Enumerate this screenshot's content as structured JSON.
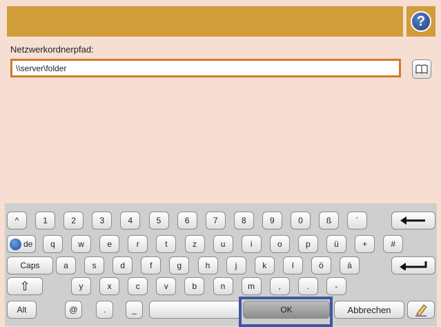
{
  "header": {
    "help_icon": "help-icon",
    "help_glyph": "?"
  },
  "form": {
    "label": "Netzwerkordnerpfad:",
    "value": "\\\\server\\folder",
    "book_icon": "address-book-icon"
  },
  "keyboard": {
    "row1": [
      "^",
      "1",
      "2",
      "3",
      "4",
      "5",
      "6",
      "7",
      "8",
      "9",
      "0",
      "ß",
      "´"
    ],
    "backspace_glyph": "⟵",
    "row2_lang": "de",
    "row2": [
      "q",
      "w",
      "e",
      "r",
      "t",
      "z",
      "u",
      "i",
      "o",
      "p",
      "ü",
      "+",
      "#"
    ],
    "caps": "Caps",
    "row3": [
      "a",
      "s",
      "d",
      "f",
      "g",
      "h",
      "j",
      "k",
      "l",
      "ö",
      "ä"
    ],
    "enter_glyph": "↵",
    "shift_glyph": "⇧",
    "row4": [
      "y",
      "x",
      "c",
      "v",
      "b",
      "n",
      "m",
      ",",
      ".",
      "-"
    ],
    "alt": "Alt",
    "at": "@",
    "dot": ".",
    "underscore": "_",
    "ok": "OK",
    "cancel": "Abbrechen",
    "edit_icon": "pencil-eraser-icon"
  }
}
